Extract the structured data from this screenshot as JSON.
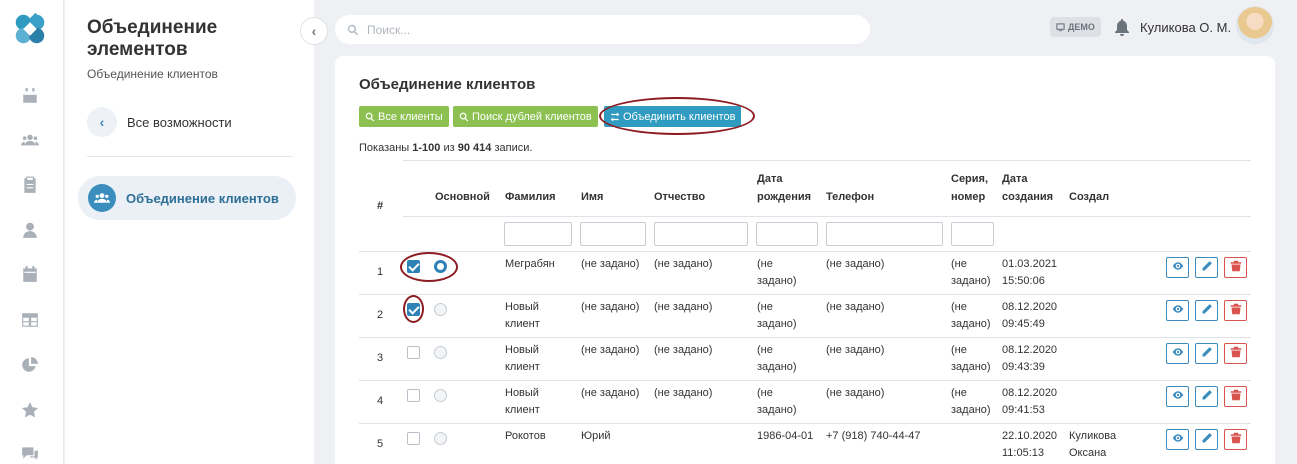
{
  "sidebar": {
    "title": "Объединение элементов",
    "subtitle": "Объединение клиентов",
    "back_label": "Все возможности",
    "active_item": "Объединение клиентов"
  },
  "rail_icons": [
    "calendar-icon",
    "users-icon",
    "clipboard-icon",
    "doctor-icon",
    "calendar-alt-icon",
    "table-icon",
    "pie-chart-icon",
    "star-icon",
    "chat-icon"
  ],
  "topbar": {
    "search_placeholder": "Поиск...",
    "demo_label": "ДЕМО",
    "user_name": "Куликова О. М."
  },
  "page": {
    "title": "Объединение клиентов",
    "buttons": {
      "all_clients": "Все клиенты",
      "find_duplicates": "Поиск дублей клиентов",
      "merge": "Объединить клиентов"
    },
    "summary_prefix": "Показаны ",
    "summary_range": "1-100",
    "summary_mid": " из ",
    "summary_total": "90 414",
    "summary_suffix": " записи."
  },
  "table": {
    "headers": {
      "num": "#",
      "main": "Основной",
      "lastname": "Фамилия",
      "firstname": "Имя",
      "patronymic": "Отчество",
      "birthdate_1": "Дата",
      "birthdate_2": "рождения",
      "phone": "Телефон",
      "series_1": "Серия,",
      "series_2": "номер",
      "created_1": "Дата",
      "created_2": "создания",
      "author": "Создал"
    },
    "rows": [
      {
        "num": "1",
        "checked": true,
        "primary": true,
        "lastname_1": "Меграбян",
        "lastname_2": "",
        "firstname": "(не задано)",
        "patronymic": "(не задано)",
        "birth_1": "(не",
        "birth_2": "задано)",
        "phone": "(не задано)",
        "series_1": "(не",
        "series_2": "задано)",
        "created_1": "01.03.2021",
        "created_2": "15:50:06",
        "author_1": "",
        "author_2": ""
      },
      {
        "num": "2",
        "checked": true,
        "primary": false,
        "lastname_1": "Новый",
        "lastname_2": "клиент",
        "firstname": "(не задано)",
        "patronymic": "(не задано)",
        "birth_1": "(не",
        "birth_2": "задано)",
        "phone": "(не задано)",
        "series_1": "(не",
        "series_2": "задано)",
        "created_1": "08.12.2020",
        "created_2": "09:45:49",
        "author_1": "",
        "author_2": ""
      },
      {
        "num": "3",
        "checked": false,
        "primary": false,
        "lastname_1": "Новый",
        "lastname_2": "клиент",
        "firstname": "(не задано)",
        "patronymic": "(не задано)",
        "birth_1": "(не",
        "birth_2": "задано)",
        "phone": "(не задано)",
        "series_1": "(не",
        "series_2": "задано)",
        "created_1": "08.12.2020",
        "created_2": "09:43:39",
        "author_1": "",
        "author_2": ""
      },
      {
        "num": "4",
        "checked": false,
        "primary": false,
        "lastname_1": "Новый",
        "lastname_2": "клиент",
        "firstname": "(не задано)",
        "patronymic": "(не задано)",
        "birth_1": "(не",
        "birth_2": "задано)",
        "phone": "(не задано)",
        "series_1": "(не",
        "series_2": "задано)",
        "created_1": "08.12.2020",
        "created_2": "09:41:53",
        "author_1": "",
        "author_2": ""
      },
      {
        "num": "5",
        "checked": false,
        "primary": false,
        "lastname_1": "Рокотов",
        "lastname_2": "",
        "firstname": "Юрий",
        "patronymic": "",
        "birth_1": "1986-04-01",
        "birth_2": "",
        "phone": "+7 (918) 740-44-47",
        "series_1": "",
        "series_2": "",
        "created_1": "22.10.2020",
        "created_2": "11:05:13",
        "author_1": "Куликова",
        "author_2": "Оксана"
      }
    ]
  },
  "colors": {
    "accent": "#2f9bc1",
    "green": "#8cc152",
    "danger": "#d9534f",
    "annotation": "#8c1c20"
  }
}
